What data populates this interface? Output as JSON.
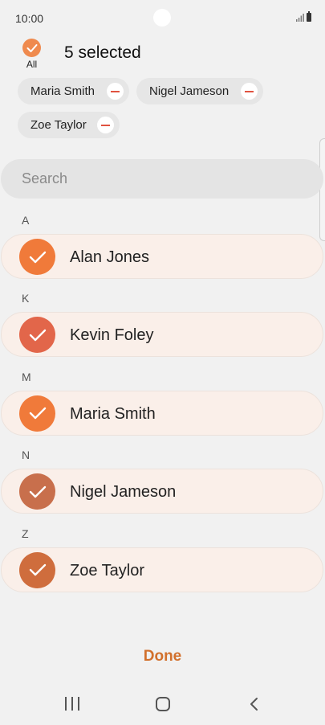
{
  "status_bar": {
    "time": "10:00"
  },
  "header": {
    "all_label": "All",
    "selected_text": "5 selected"
  },
  "chips": [
    {
      "name": "Maria Smith"
    },
    {
      "name": "Nigel Jameson"
    },
    {
      "name": "Zoe Taylor"
    }
  ],
  "search": {
    "placeholder": "Search",
    "value": ""
  },
  "sections": [
    {
      "letter": "A",
      "contact": "Alan Jones",
      "avatar_color": "#f07a3a"
    },
    {
      "letter": "K",
      "contact": "Kevin Foley",
      "avatar_color": "#e2664a"
    },
    {
      "letter": "M",
      "contact": "Maria Smith",
      "avatar_color": "#f07a3a"
    },
    {
      "letter": "N",
      "contact": "Nigel Jameson",
      "avatar_color": "#c86f4c"
    },
    {
      "letter": "Z",
      "contact": "Zoe Taylor",
      "avatar_color": "#cf6d3d"
    }
  ],
  "actions": {
    "done_label": "Done"
  },
  "colors": {
    "accent": "#d2702c",
    "chip_remove": "#e0523f",
    "row_background": "#faefe9"
  }
}
